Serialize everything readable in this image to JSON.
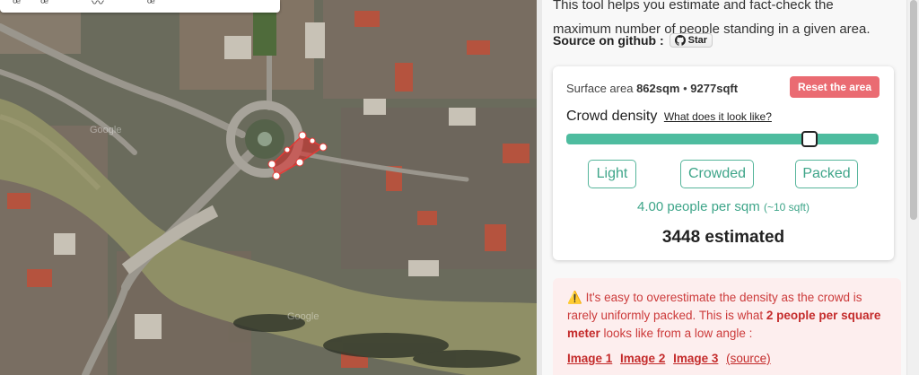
{
  "map": {
    "search_text": "ꟹꟹ 〰 ꟹ",
    "watermarks": [
      "Google",
      "Google"
    ]
  },
  "intro": {
    "line1": "This tool helps you estimate and fact-check the",
    "line2": "maximum number of people standing in a given area."
  },
  "source": {
    "label": "Source on github :",
    "star_label": "Star"
  },
  "card": {
    "surface_prefix": "Surface area",
    "surface_sqm": "862sqm",
    "surface_sep": "•",
    "surface_sqft": "9277sqft",
    "reset_label": "Reset the area",
    "density_label": "Crowd density",
    "density_link": "What does it look like?",
    "density_level": 0.78,
    "chips": {
      "light": "Light",
      "crowded": "Crowded",
      "packed": "Packed"
    },
    "ppsqm_main": "4.00 people per sqm",
    "ppsqm_sub": "(~10 sqft)",
    "estimate": "3448 estimated"
  },
  "warning": {
    "icon": "warning-icon",
    "text1": "It's easy to overestimate the density as the crowd is rarely uniformly packed. This is what",
    "bold": "2 people per square meter",
    "text2": "looks like from a low angle :",
    "links": [
      "Image 1",
      "Image 2",
      "Image 3"
    ],
    "source_link": "(source)"
  },
  "colors": {
    "accent_green": "#4ebc9f",
    "reset_red": "#ea6b72",
    "warning_text": "#cc3a3a",
    "warning_bg": "#fdeeee"
  }
}
